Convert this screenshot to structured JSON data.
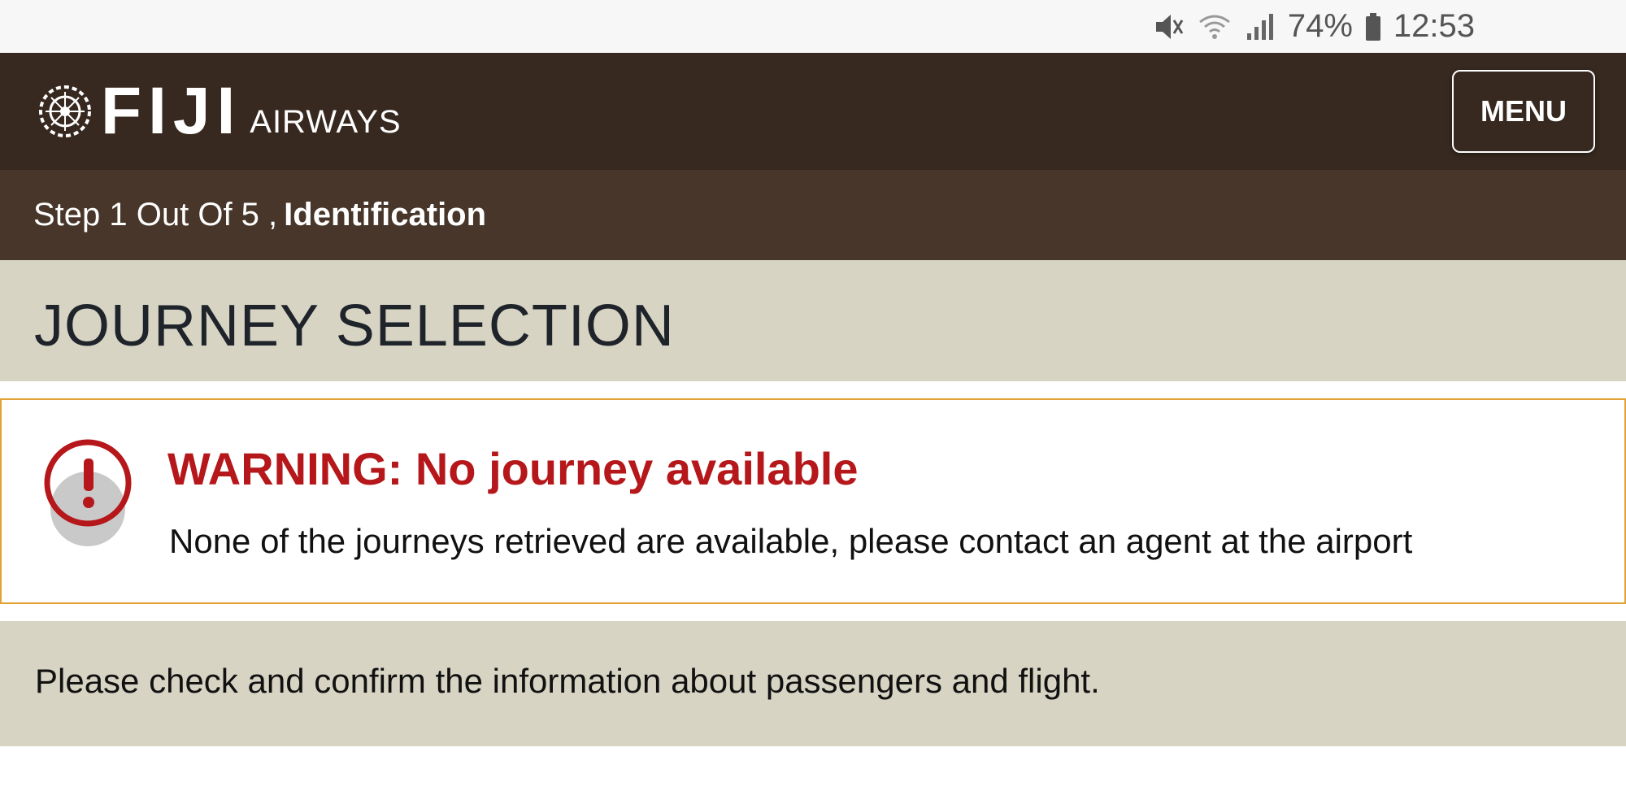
{
  "status_bar": {
    "battery_percent": "74%",
    "time": "12:53",
    "icons": [
      "mute-icon",
      "wifi-icon",
      "signal-icon",
      "battery-icon"
    ]
  },
  "header": {
    "logo_main": "FIJI",
    "logo_sub": "AIRWAYS",
    "menu_label": "MENU"
  },
  "step_bar": {
    "step_text": "Step 1 Out Of 5 ,",
    "step_name": "Identification"
  },
  "page": {
    "title": "JOURNEY SELECTION"
  },
  "warning": {
    "title": "WARNING: No journey available",
    "message": "None of the journeys retrieved are available, please contact an agent at the airport",
    "icon": "exclamation-circle-icon"
  },
  "info": {
    "text": "Please check and confirm the information about passengers and flight."
  },
  "colors": {
    "header_bg": "#37291f",
    "step_bar_bg": "#473629",
    "title_bar_bg": "#d7d4c4",
    "warning_border": "#e2a233",
    "warning_red": "#b5171a"
  }
}
